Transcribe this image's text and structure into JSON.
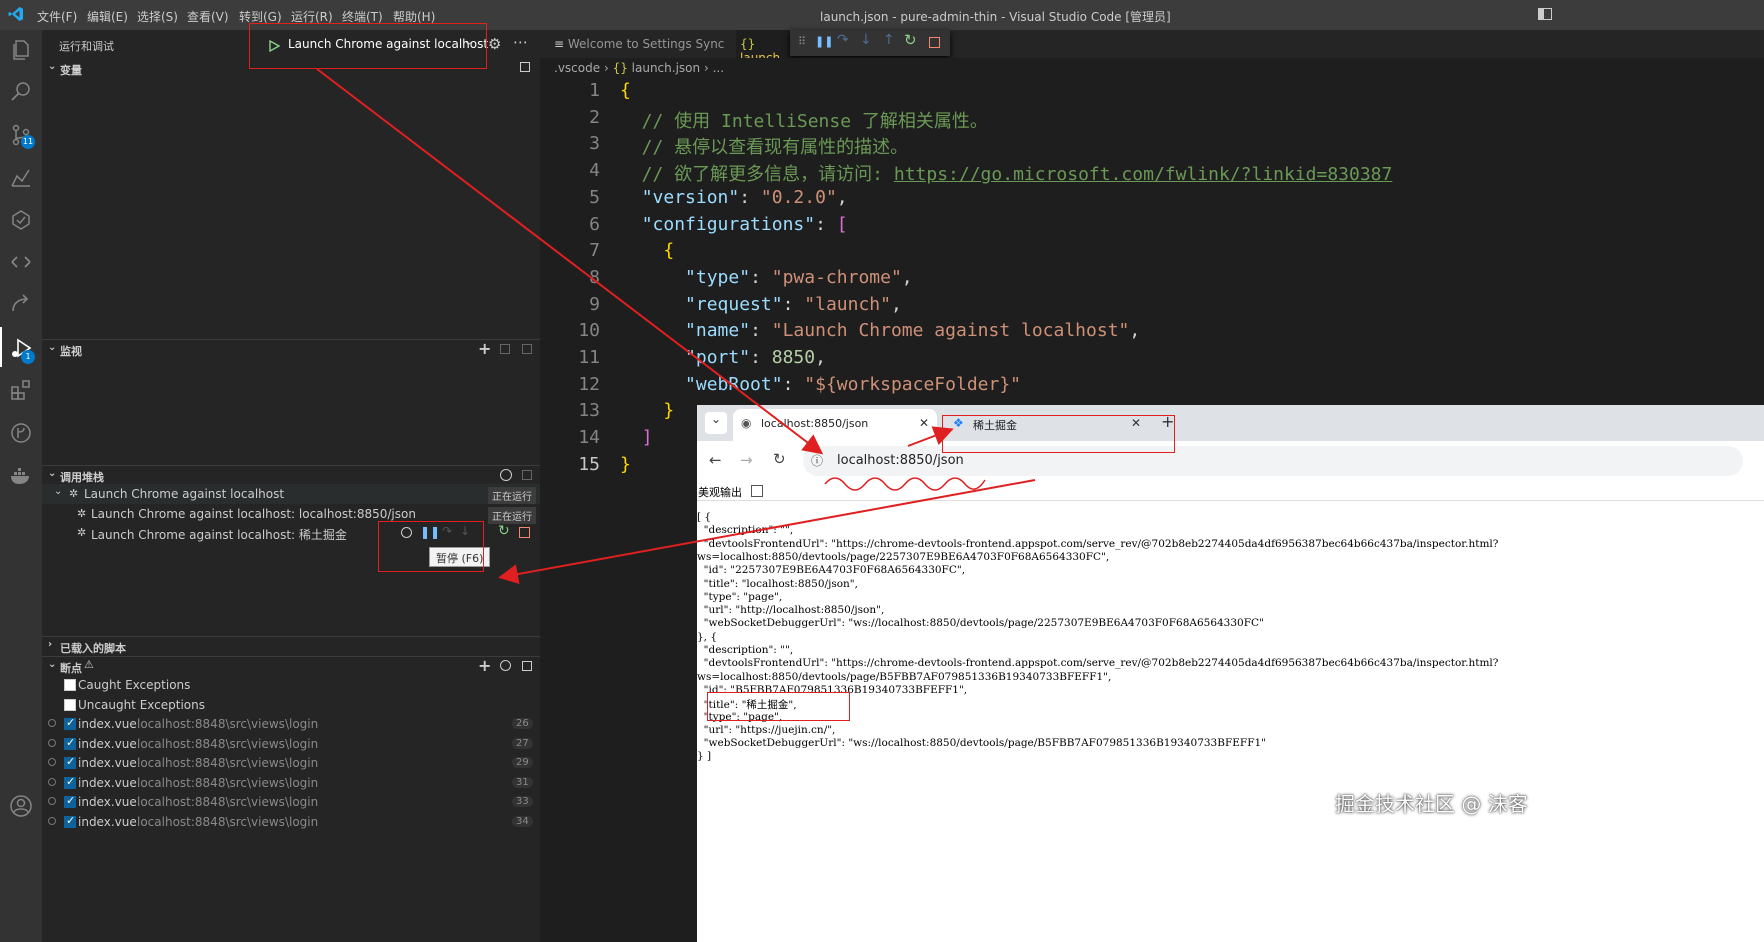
{
  "titlebar": {
    "menus": [
      "文件(F)",
      "编辑(E)",
      "选择(S)",
      "查看(V)",
      "转到(G)",
      "运行(R)",
      "终端(T)",
      "帮助(H)"
    ],
    "title": "launch.json - pure-admin-thin - Visual Studio Code [管理员]"
  },
  "activity": {
    "scm_badge": "11",
    "debug_badge": "1"
  },
  "sidebar": {
    "header": "运行和调试",
    "launch_config": "Launch Chrome against localhost",
    "variables": "变量",
    "watch": "监视",
    "call_stack": {
      "title": "调用堆栈",
      "items": [
        {
          "label": "Launch Chrome against localhost",
          "status": "正在运行"
        },
        {
          "label": "Launch Chrome against localhost: localhost:8850/json",
          "status": "正在运行"
        },
        {
          "label": "Launch Chrome against localhost: 稀土掘金",
          "status": ""
        }
      ],
      "tooltip": "暂停 (F6)"
    },
    "loaded_scripts": "已载入的脚本",
    "breakpoints": {
      "title": "断点",
      "exceptions": [
        "Caught Exceptions",
        "Uncaught Exceptions"
      ],
      "items": [
        {
          "file": "index.vue",
          "path": "localhost:8848\\src\\views\\login",
          "line": "26"
        },
        {
          "file": "index.vue",
          "path": "localhost:8848\\src\\views\\login",
          "line": "27"
        },
        {
          "file": "index.vue",
          "path": "localhost:8848\\src\\views\\login",
          "line": "29"
        },
        {
          "file": "index.vue",
          "path": "localhost:8848\\src\\views\\login",
          "line": "31"
        },
        {
          "file": "index.vue",
          "path": "localhost:8848\\src\\views\\login",
          "line": "33"
        },
        {
          "file": "index.vue",
          "path": "localhost:8848\\src\\views\\login",
          "line": "34"
        }
      ]
    }
  },
  "editor": {
    "tabs": [
      "Welcome to Settings Sync",
      "launch."
    ],
    "breadcrumb": [
      ".vscode",
      "launch.json",
      "..."
    ],
    "lines": [
      "{",
      "  // 使用 IntelliSense 了解相关属性。",
      "  // 悬停以查看现有属性的描述。",
      "  // 欲了解更多信息，请访问: https://go.microsoft.com/fwlink/?linkid=830387",
      "  \"version\": \"0.2.0\",",
      "  \"configurations\": [",
      "    {",
      "      \"type\": \"pwa-chrome\",",
      "      \"request\": \"launch\",",
      "      \"name\": \"Launch Chrome against localhost\",",
      "      \"port\": 8850,",
      "      \"webRoot\": \"${workspaceFolder}\"",
      "    }",
      "  ]",
      "}"
    ]
  },
  "browser": {
    "tab1": "localhost:8850/json",
    "tab2": "稀土掘金",
    "address": "localhost:8850/json",
    "pretty_print": "美观输出",
    "json_lines": [
      "[ {",
      "  \"description\": \"\",",
      "  \"devtoolsFrontendUrl\": \"https://chrome-devtools-frontend.appspot.com/serve_rev/@702b8eb2274405da4df6956387bec64b66c437ba/inspector.html?",
      "ws=localhost:8850/devtools/page/2257307E9BE6A4703F0F68A6564330FC\",",
      "  \"id\": \"2257307E9BE6A4703F0F68A6564330FC\",",
      "  \"title\": \"localhost:8850/json\",",
      "  \"type\": \"page\",",
      "  \"url\": \"http://localhost:8850/json\",",
      "  \"webSocketDebuggerUrl\": \"ws://localhost:8850/devtools/page/2257307E9BE6A4703F0F68A6564330FC\"",
      "}, {",
      "  \"description\": \"\",",
      "  \"devtoolsFrontendUrl\": \"https://chrome-devtools-frontend.appspot.com/serve_rev/@702b8eb2274405da4df6956387bec64b66c437ba/inspector.html?",
      "ws=localhost:8850/devtools/page/B5FBB7AF079851336B19340733BFEFF1\",",
      "  \"id\": \"B5FBB7AF079851336B19340733BFEFF1\",",
      "  \"title\": \"稀土掘金\",",
      "  \"type\": \"page\",",
      "  \"url\": \"https://juejin.cn/\",",
      "  \"webSocketDebuggerUrl\": \"ws://localhost:8850/devtools/page/B5FBB7AF079851336B19340733BFEFF1\"",
      "} ]"
    ]
  },
  "watermark": "掘金技术社区 @ 沫客",
  "colors": {
    "accent": "#007acc",
    "annotation_red": "#e02020",
    "string": "#ce9178",
    "key": "#9cdcfe",
    "comment": "#6a9955",
    "number": "#b5cea8"
  }
}
